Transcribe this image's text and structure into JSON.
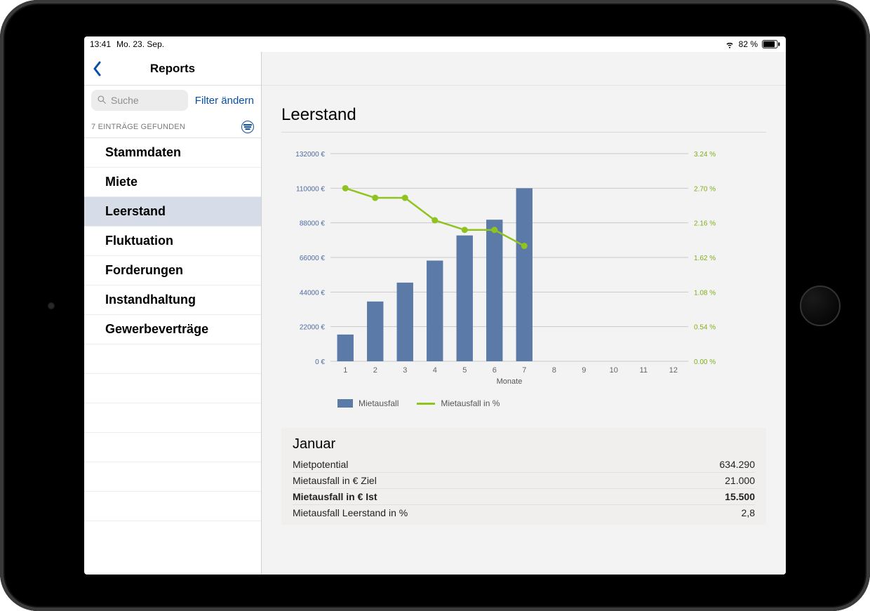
{
  "status": {
    "time": "13:41",
    "date": "Mo. 23. Sep.",
    "battery_pct": "82 %"
  },
  "nav": {
    "title": "Reports"
  },
  "search": {
    "placeholder": "Suche",
    "filter_label": "Filter ändern"
  },
  "results": {
    "count_label": "7 EINTRÄGE GEFUNDEN"
  },
  "sidebar": {
    "items": [
      {
        "label": "Stammdaten",
        "selected": false
      },
      {
        "label": "Miete",
        "selected": false
      },
      {
        "label": "Leerstand",
        "selected": true
      },
      {
        "label": "Fluktuation",
        "selected": false
      },
      {
        "label": "Forderungen",
        "selected": false
      },
      {
        "label": "Instandhaltung",
        "selected": false
      },
      {
        "label": "Gewerbeverträge",
        "selected": false
      }
    ]
  },
  "page": {
    "title": "Leerstand"
  },
  "chart_data": {
    "type": "bar+line",
    "xlabel": "Monate",
    "categories": [
      "1",
      "2",
      "3",
      "4",
      "5",
      "6",
      "7",
      "8",
      "9",
      "10",
      "11",
      "12"
    ],
    "y_left": {
      "label": "",
      "unit": "€",
      "ticks": [
        0,
        22000,
        44000,
        66000,
        88000,
        110000,
        132000
      ],
      "tick_labels": [
        "0 €",
        "22000 €",
        "44000 €",
        "66000 €",
        "88000 €",
        "110000 €",
        "132000 €"
      ]
    },
    "y_right": {
      "label": "",
      "unit": "%",
      "ticks": [
        0.0,
        0.54,
        1.08,
        1.62,
        2.16,
        2.7,
        3.24
      ],
      "tick_labels": [
        "0.00 %",
        "0.54 %",
        "1.08 %",
        "1.62 %",
        "2.16 %",
        "2.70 %",
        "3.24 %"
      ]
    },
    "series": [
      {
        "name": "Mietausfall",
        "kind": "bar",
        "axis": "left",
        "values": [
          17000,
          38000,
          50000,
          64000,
          80000,
          90000,
          110000,
          null,
          null,
          null,
          null,
          null
        ]
      },
      {
        "name": "Mietausfall in %",
        "kind": "line",
        "axis": "right",
        "values": [
          2.7,
          2.55,
          2.55,
          2.2,
          2.05,
          2.05,
          1.8,
          null,
          null,
          null,
          null,
          null
        ]
      }
    ],
    "legend": [
      "Mietausfall",
      "Mietausfall in %"
    ]
  },
  "detail": {
    "month": "Januar",
    "rows": [
      {
        "label": "Mietpotential",
        "value": "634.290",
        "bold": false
      },
      {
        "label": "Mietausfall in € Ziel",
        "value": "21.000",
        "bold": false
      },
      {
        "label": "Mietausfall in € Ist",
        "value": "15.500",
        "bold": true
      },
      {
        "label": "Mietausfall Leerstand in %",
        "value": "2,8",
        "bold": false
      }
    ]
  },
  "colors": {
    "bar": "#5b7aa7",
    "line": "#8fc31f",
    "grid": "#b8b8b8",
    "accent": "#0a4fa5"
  }
}
